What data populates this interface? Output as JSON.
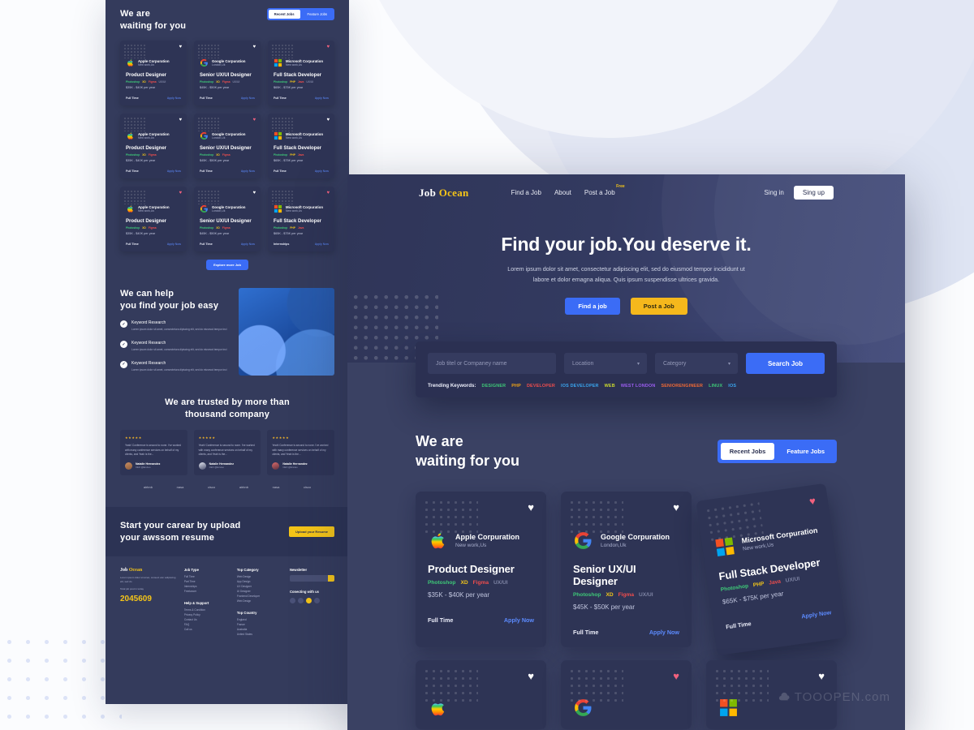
{
  "brand": {
    "name_dark": "Job",
    "name_accent": "Ocean"
  },
  "nav": {
    "links": [
      {
        "label": "Find a Job"
      },
      {
        "label": "About"
      },
      {
        "label": "Post a Job",
        "badge": "Free"
      }
    ],
    "sign_in": "Sing in",
    "sign_up": "Sing up"
  },
  "hero": {
    "title": "Find your job.You deserve it.",
    "subtitle_line1": "Lorem ipsum dolor sit amet, consectetur adipiscing elit, sed do eiusmod tempor incididunt ut",
    "subtitle_line2": "labore et dolor emagna aliqua. Quis ipsum suspendisse ultrices gravida.",
    "btn_find": "Find a job",
    "btn_post": "Post a Job"
  },
  "search": {
    "job_placeholder": "Job titel or Companey name",
    "location_placeholder": "Location",
    "category_placeholder": "Category",
    "button": "Search Job",
    "trending_label": "Trending Keywords:",
    "keywords": [
      {
        "text": "DESIGNER",
        "color": "#3ec978"
      },
      {
        "text": "PHP",
        "color": "#f0a315"
      },
      {
        "text": "DEVELOPER",
        "color": "#ef4d4d"
      },
      {
        "text": "IOS DEVELOPER",
        "color": "#3aa6f0"
      },
      {
        "text": "WEB",
        "color": "#c9d92e"
      },
      {
        "text": "WEST LONDON",
        "color": "#9b5df0"
      },
      {
        "text": "SENIORENGINEER",
        "color": "#f06a35"
      },
      {
        "text": "LINUX",
        "color": "#3ec978"
      },
      {
        "text": "IOS",
        "color": "#3aa6f0"
      }
    ]
  },
  "jobs_section": {
    "title_line1": "We are",
    "title_line2": "waiting for you",
    "tab_recent": "Recent Jobs",
    "tab_feature": "Feature Jobs",
    "explore_button": "Explore more Job",
    "cards": [
      {
        "company": "Apple Corpuration",
        "location": "New work,Us",
        "title": "Product Designer",
        "tags": [
          {
            "text": "Photoshop",
            "color": "#3ec978"
          },
          {
            "text": "XD",
            "color": "#f0c419"
          },
          {
            "text": "Figma",
            "color": "#ef4d4d"
          },
          {
            "text": "UX/UI",
            "color": "#7d83a3"
          }
        ],
        "salary": "$35K - $40K per year",
        "type": "Full Time",
        "apply": "Apply Now",
        "logo": "apple-logo",
        "favorited": false
      },
      {
        "company": "Google Corpuration",
        "location": "London,Uk",
        "title": "Senior UX/UI Designer",
        "tags": [
          {
            "text": "Photoshop",
            "color": "#3ec978"
          },
          {
            "text": "XD",
            "color": "#f0c419"
          },
          {
            "text": "Figma",
            "color": "#ef4d4d"
          },
          {
            "text": "UX/UI",
            "color": "#7d83a3"
          }
        ],
        "salary": "$45K - $50K per year",
        "type": "Full Time",
        "apply": "Apply Now",
        "logo": "google-logo",
        "favorited": false
      },
      {
        "company": "Microsoft Corpuration",
        "location": "New work,Us",
        "title": "Full Stack Developer",
        "tags": [
          {
            "text": "Photoshop",
            "color": "#3ec978"
          },
          {
            "text": "PHP",
            "color": "#f0c419"
          },
          {
            "text": "Java",
            "color": "#ef4d4d"
          },
          {
            "text": "UX/UI",
            "color": "#7d83a3"
          }
        ],
        "salary": "$65K - $75K per year",
        "type": "Full Time",
        "apply": "Apply Now",
        "logo": "microsoft-logo",
        "favorited": true
      }
    ]
  },
  "help_section": {
    "title_line1": "We can help",
    "title_line2": "you find your job easy",
    "items": [
      {
        "title": "Keyword Research",
        "text": "Lorem ipsum dolor sit amet, consectetura dipiscing elit, sed do eiusmod tempor inci"
      },
      {
        "title": "Keyword Research",
        "text": "Lorem ipsum dolor sit amet, consectetura dipiscing elit, sed do eiusmod tempor inci"
      },
      {
        "title": "Keyword Research",
        "text": "Lorem ipsum dolor sit amet, consectetura dipiscing elit, sed do eiusmod tempor inci"
      }
    ]
  },
  "trust_section": {
    "title_line1": "We are trusted by more than",
    "title_line2": "thousand company",
    "stars": "★★★★★",
    "testimonials": [
      {
        "quote": "Yeah! Conference is second to none. I've worked with many conference services on behalf of my clients, and Yeah is the...",
        "name": "Natalie Hernandez",
        "role": "CEO @Envteo"
      },
      {
        "quote": "Yeah! Conference is second to none. I've worked with many conference services on behalf of my clients, and Yeah is the...",
        "name": "Natalie Hernandez",
        "role": "CEO @Envteo"
      },
      {
        "quote": "Yeah! Conference is second to none. I've worked with many conference services on behalf of my clients, and Yeah is the...",
        "name": "Natalie Hernandez",
        "role": "CEO @Envteo"
      }
    ],
    "brands": [
      "airbnb",
      "nasa",
      "cisco",
      "airbnb",
      "nasa",
      "cisco"
    ]
  },
  "cta": {
    "title_line1": "Start your carear by upload",
    "title_line2": "your awssom resume",
    "button": "Upload your Resume"
  },
  "footer": {
    "about_text": "Lorem ipsum dolor sit amet, consect etur adipiscing elit, sed do",
    "total_label": "Total job post in today",
    "total_value": "2045609",
    "col_job_type": {
      "heading": "Job Type",
      "items": [
        "Full Time",
        "Part Time",
        "Internships",
        "Freelancer"
      ]
    },
    "col_help": {
      "heading": "Help & Support",
      "items": [
        "Terms & Condition",
        "Privacy Policy",
        "Contact Us",
        "FAQ",
        "Call us"
      ]
    },
    "col_category": {
      "heading": "Top Category",
      "items": [
        "Web Design",
        "App Design",
        "UX Designer",
        "UI Designer",
        "Frontend Developer",
        "Web Design"
      ]
    },
    "col_country": {
      "heading": "Top Country",
      "items": [
        "England",
        "France",
        "Australia",
        "United States"
      ]
    },
    "newsletter": {
      "heading": "Newsletter",
      "placeholder": "Your email here",
      "connect": "Conecting with us"
    }
  },
  "watermark": {
    "text": "TOOOPEN.com",
    "icon": "cloud-icon"
  }
}
